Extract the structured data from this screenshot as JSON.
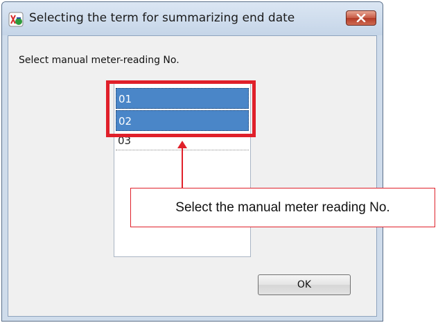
{
  "window": {
    "title": "Selecting the term for summarizing end date"
  },
  "dialog": {
    "prompt": "Select manual meter-reading No.",
    "list_items": [
      {
        "label": "01",
        "selected": true
      },
      {
        "label": "02",
        "selected": true
      },
      {
        "label": "03",
        "selected": false
      }
    ],
    "ok_label": "OK"
  },
  "annotation": {
    "callout_text": "Select the manual meter reading No."
  },
  "colors": {
    "selection": "#4a86c8",
    "annotation_red": "#e0202a"
  }
}
